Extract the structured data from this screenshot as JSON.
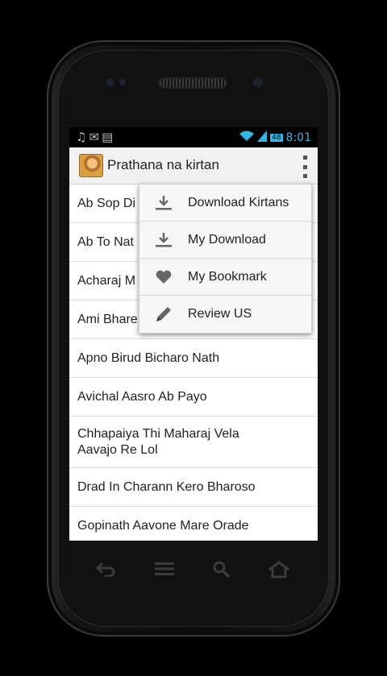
{
  "status_bar": {
    "time": "8:01",
    "battery": "48",
    "left_icons": [
      "music-note-icon",
      "mail-icon",
      "sd-card-icon"
    ]
  },
  "action_bar": {
    "title": "Prathana na kirtan"
  },
  "list": {
    "items": [
      {
        "text": "Ab Sop Di"
      },
      {
        "text": "Ab To Nat"
      },
      {
        "text": "Acharaj M"
      },
      {
        "text": "Ami Bhare"
      },
      {
        "text": "Apno Birud Bicharo Nath"
      },
      {
        "text": "Avichal Aasro Ab Payo"
      },
      {
        "text": "Chhapaiya Thi Maharaj Vela Aavajo Re Lol"
      },
      {
        "text": "Drad In Charann Kero Bharoso"
      },
      {
        "text": "Gopinath Aavone Mare Orade"
      }
    ]
  },
  "menu": {
    "items": [
      {
        "label": "Download Kirtans",
        "icon": "download-icon"
      },
      {
        "label": "My Download",
        "icon": "download-icon"
      },
      {
        "label": "My Bookmark",
        "icon": "heart-icon"
      },
      {
        "label": "Review US",
        "icon": "pencil-icon"
      }
    ]
  },
  "colors": {
    "accent": "#33b5e5",
    "screen_bg": "#ffffff",
    "menu_bg": "#f6f6f6"
  }
}
